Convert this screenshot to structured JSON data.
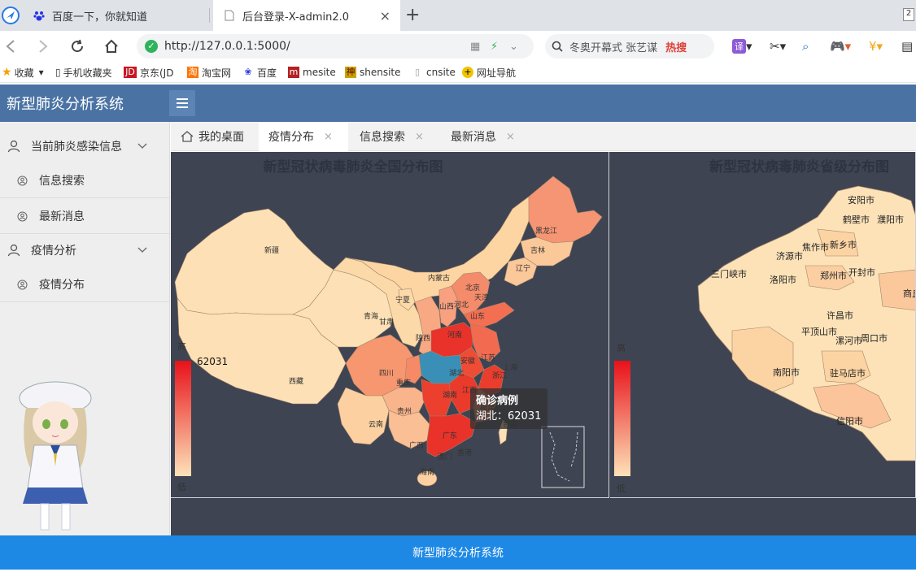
{
  "browser": {
    "tabs": [
      {
        "title": "百度一下，你就知道"
      },
      {
        "title": "后台登录-X-admin2.0",
        "close": "×"
      }
    ],
    "new_tab": "+",
    "corner_badge": "2",
    "url": "http://127.0.0.1:5000/",
    "search_placeholder": "冬奥开幕式 张艺谋",
    "search_hot": "热搜",
    "bookmarks": [
      {
        "label": "收藏"
      },
      {
        "label": "手机收藏夹"
      },
      {
        "label": "京东(JD"
      },
      {
        "label": "淘宝网"
      },
      {
        "label": "百度"
      },
      {
        "label": "mesite"
      },
      {
        "label": "shensite"
      },
      {
        "label": "cnsite"
      },
      {
        "label": "网址导航"
      }
    ]
  },
  "app": {
    "title": "新型肺炎分析系统",
    "footer": "新型肺炎分析系统",
    "sidebar": [
      {
        "label": "当前肺炎感染信息"
      },
      {
        "label": "信息搜索"
      },
      {
        "label": "最新消息"
      },
      {
        "label": "疫情分析"
      },
      {
        "label": "疫情分布"
      }
    ],
    "tabs": [
      {
        "label": "我的桌面"
      },
      {
        "label": "疫情分布",
        "close": "×"
      },
      {
        "label": "信息搜索",
        "close": "×"
      },
      {
        "label": "最新消息",
        "close": "×"
      }
    ]
  },
  "map_left": {
    "title": "新型冠状病毒肺炎全国分布图",
    "visualmap_high": "高",
    "visualmap_low": "低",
    "visualmap_max": "62031",
    "province_labels": [
      "新疆",
      "西藏",
      "青海",
      "甘肃",
      "宁夏",
      "内蒙古",
      "四川",
      "重庆",
      "陕西",
      "山西",
      "河北",
      "北京",
      "天津",
      "山东",
      "河南",
      "湖北",
      "安徽",
      "江苏",
      "上海",
      "浙江",
      "湖南",
      "江西",
      "福建",
      "广东",
      "广西",
      "贵州",
      "云南",
      "海南",
      "香港",
      "澳门",
      "黑龙江",
      "吉林",
      "辽宁",
      "台湾"
    ],
    "tooltip_title": "确诊病例",
    "tooltip_value": "湖北：62031"
  },
  "map_right": {
    "title": "新型冠状病毒肺炎省级分布图",
    "visualmap_high": "高",
    "visualmap_low": "低",
    "city_labels": [
      "安阳市",
      "鹤壁市",
      "濮阳市",
      "焦作市",
      "新乡市",
      "三门峡市",
      "济源市",
      "洛阳市",
      "郑州市",
      "开封市",
      "商丘",
      "许昌市",
      "平顶山市",
      "漯河市",
      "周口市",
      "南阳市",
      "驻马店市",
      "信阳市"
    ]
  },
  "colors": {
    "header": "#4a73a4",
    "footer": "#1e88e5",
    "map_bg": "#3f4453",
    "highlight": "#3a8fb7",
    "high": "#e8322a",
    "low": "#fde2b8"
  }
}
